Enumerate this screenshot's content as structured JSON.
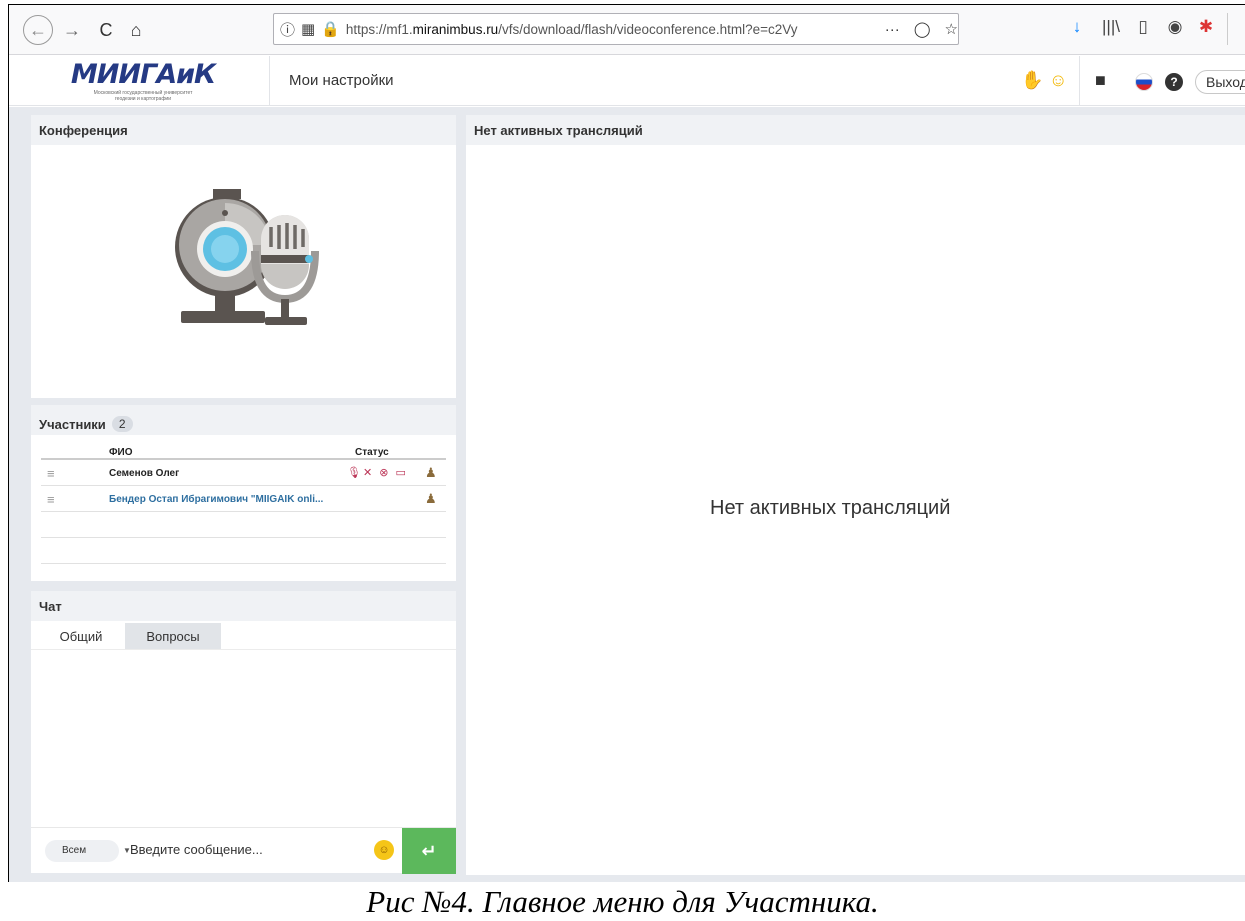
{
  "browser": {
    "url_prefix": "https://mf1.",
    "url_domain": "miranimbus.ru",
    "url_path": "/vfs/download/flash/videoconference.html?e=c2Vy",
    "nav": {
      "back_icon": "←",
      "forward_icon": "→",
      "reload_icon": "C",
      "home_icon": "⌂"
    },
    "url_icons": {
      "info": "ⓘ",
      "media": "▦",
      "lock": "🔒"
    },
    "url_actions": {
      "more": "···",
      "pocket": "◯",
      "bookmark": "☆"
    },
    "toolbar_icons": {
      "download": "↓",
      "library": "|||\\",
      "sidebar": "▯",
      "account": "◉",
      "extension": "✱"
    }
  },
  "header": {
    "logo_title": "МИИГАиК",
    "logo_subtitle_1": "Московский государственный университет",
    "logo_subtitle_2": "геодезии и картографии",
    "settings_link": "Мои настройки",
    "hand_icon": "✋",
    "emoji_icon": "☺",
    "folder_icon": "■",
    "help_icon": "?",
    "exit_label": "Выход"
  },
  "conference_panel": {
    "title": "Конференция"
  },
  "participants_panel": {
    "title": "Участники",
    "count": "2",
    "columns": {
      "name": "ФИО",
      "status": "Статус"
    },
    "rows": [
      {
        "name": "Семенов Олег",
        "status_icons": "🎙✕ ⊗ ▭",
        "role_icon": "♟",
        "style": "dark"
      },
      {
        "name": "Бендер  Остап Ибрагимович \"MIIGAIK onli...",
        "status_icons": "",
        "role_icon": "♟",
        "style": "blue"
      }
    ],
    "row_menu_icon": "≡"
  },
  "chat_panel": {
    "title": "Чат",
    "tabs": [
      "Общий",
      "Вопросы"
    ],
    "recipient": "Всем",
    "recipient_arrow": "▼",
    "input_placeholder": "Введите сообщение...",
    "emoji_icon": "☺",
    "send_icon": "↵"
  },
  "stream_panel": {
    "title": "Нет активных трансляций",
    "empty_message": "Нет активных трансляций"
  },
  "caption": "Рис №4. Главное меню для Участника."
}
